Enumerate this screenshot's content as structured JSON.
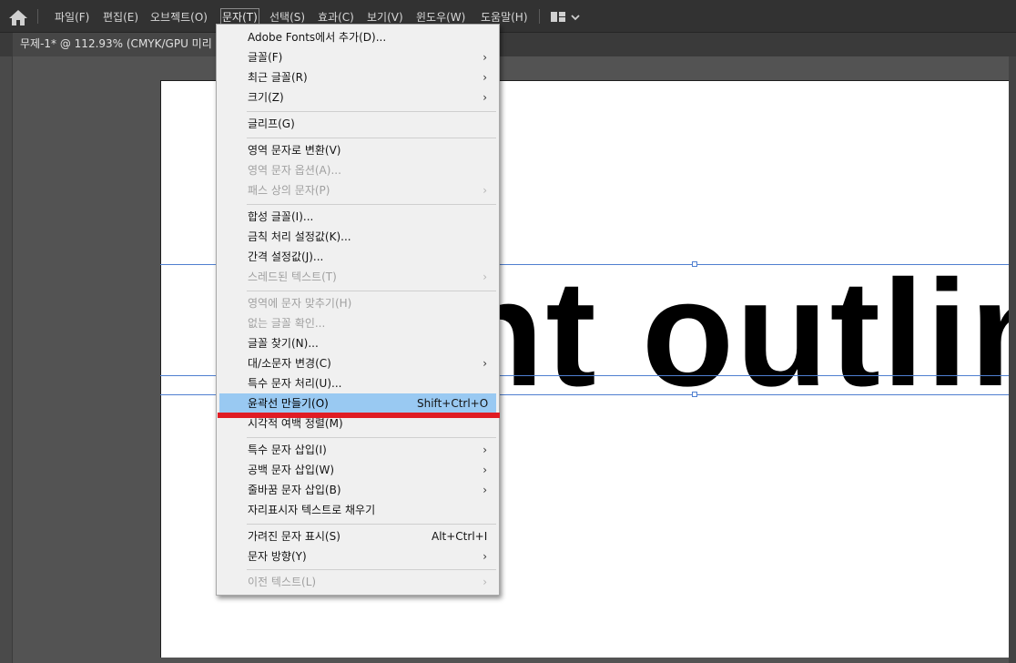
{
  "menubar": {
    "items": [
      "파일(F)",
      "편집(E)",
      "오브젝트(O)",
      "문자(T)",
      "선택(S)",
      "효과(C)",
      "보기(V)",
      "윈도우(W)",
      "도움말(H)"
    ],
    "active_item": "문자(T)"
  },
  "icons": {
    "home": "home-icon",
    "workspace": "workspace-layout-icon",
    "dropdown": "chevron-down-icon",
    "submenu": "chevron-right-icon"
  },
  "document": {
    "tab_title": "무제-1* @ 112.93% (CMYK/GPU 미리"
  },
  "canvas": {
    "text": "nt outlin"
  },
  "type_menu": {
    "adobe_fonts": "Adobe Fonts에서 추가(D)...",
    "font": "글꼴(F)",
    "recent_fonts": "최근 글꼴(R)",
    "size": "크기(Z)",
    "glyphs": "글리프(G)",
    "convert_area": "영역 문자로 변환(V)",
    "area_options": "영역 문자 옵션(A)...",
    "type_on_path": "패스 상의 문자(P)",
    "composite_fonts": "합성 글꼴(I)...",
    "kinsoku": "금칙 처리 설정값(K)...",
    "mojikumi": "간격 설정값(J)...",
    "threaded_text": "스레드된 텍스트(T)",
    "fit_headline": "영역에 문자 맞추기(H)",
    "resolve_missing": "없는 글꼴 확인...",
    "find_font": "글꼴 찾기(N)...",
    "change_case": "대/소문자 변경(C)",
    "smart_punct": "특수 문자 처리(U)...",
    "create_outlines": "윤곽선 만들기(O)",
    "create_outlines_shortcut": "Shift+Ctrl+O",
    "optical_margin": "시각적 여백 정렬(M)",
    "insert_special": "특수 문자 삽입(I)",
    "insert_whitespace": "공백 문자 삽입(W)",
    "insert_break": "줄바꿈 문자 삽입(B)",
    "fill_placeholder": "자리표시자 텍스트로 채우기",
    "show_hidden": "가려진 문자 표시(S)",
    "show_hidden_shortcut": "Alt+Ctrl+I",
    "orientation": "문자 방향(Y)",
    "legacy_text": "이전 텍스트(L)",
    "arrow_glyph": "›"
  },
  "colors": {
    "menubar_bg": "#323232",
    "menu_bg": "#f0f0f0",
    "highlight": "#99c9f2",
    "annotation_red": "#e01c24",
    "selection_blue": "#4f7fd0"
  }
}
